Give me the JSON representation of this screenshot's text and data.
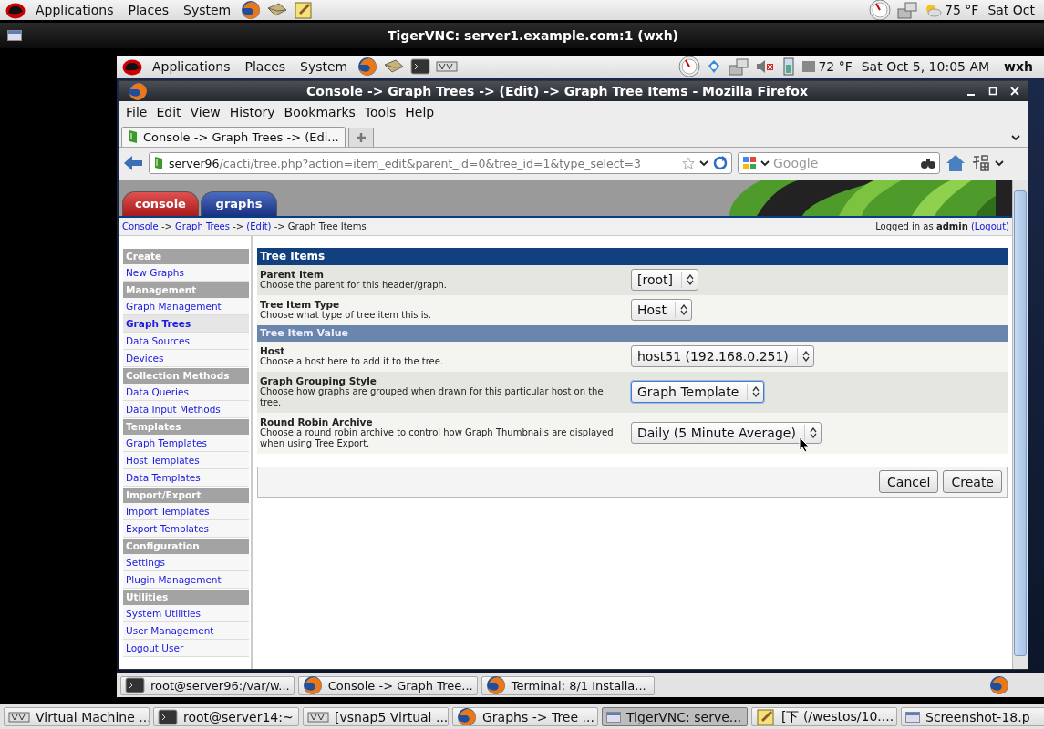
{
  "outer_panel": {
    "menus": [
      "Applications",
      "Places",
      "System"
    ],
    "weather": "75 °F",
    "clock": "Sat Oct"
  },
  "vnc_window": {
    "title": "TigerVNC: server1.example.com:1 (wxh)"
  },
  "inner_panel": {
    "menus": [
      "Applications",
      "Places",
      "System"
    ],
    "weather": "72 °F",
    "clock": "Sat Oct  5, 10:05 AM",
    "user": "wxh"
  },
  "browser": {
    "title": "Console -> Graph Trees -> (Edit) -> Graph Tree Items - Mozilla Firefox",
    "menu": [
      "File",
      "Edit",
      "View",
      "History",
      "Bookmarks",
      "Tools",
      "Help"
    ],
    "tabs": [
      {
        "label": "Console -> Graph Trees -> (Edi...",
        "selected": true
      }
    ],
    "url_host": "server96",
    "url_path": "/cacti/tree.php?action=item_edit&parent_id=0&tree_id=1&type_select=3",
    "search_placeholder": "Google"
  },
  "cacti": {
    "tabs": [
      {
        "label": "console",
        "selected": true
      },
      {
        "label": "graphs",
        "selected": false
      }
    ],
    "breadcrumb": {
      "links": [
        "Console",
        "Graph Trees",
        "(Edit)"
      ],
      "separator": "->",
      "current": "Graph Tree Items"
    },
    "login": "Logged in as **admin**",
    "logout": "(Logout)",
    "sidebar": [
      {
        "title": "Create",
        "items": [
          {
            "label": "New Graphs",
            "selected": false
          }
        ]
      },
      {
        "title": "Management",
        "items": [
          {
            "label": "Graph Management",
            "selected": false
          },
          {
            "label": "Graph Trees",
            "selected": true
          },
          {
            "label": "Data Sources",
            "selected": false
          },
          {
            "label": "Devices",
            "selected": false
          }
        ]
      },
      {
        "title": "Collection Methods",
        "items": [
          {
            "label": "Data Queries",
            "selected": false
          },
          {
            "label": "Data Input Methods",
            "selected": false
          }
        ]
      },
      {
        "title": "Templates",
        "items": [
          {
            "label": "Graph Templates",
            "selected": false
          },
          {
            "label": "Host Templates",
            "selected": false
          },
          {
            "label": "Data Templates",
            "selected": false
          }
        ]
      },
      {
        "title": "Import/Export",
        "items": [
          {
            "label": "Import Templates",
            "selected": false
          },
          {
            "label": "Export Templates",
            "selected": false
          }
        ]
      },
      {
        "title": "Configuration",
        "items": [
          {
            "label": "Settings",
            "selected": false
          },
          {
            "label": "Plugin Management",
            "selected": false
          }
        ]
      },
      {
        "title": "Utilities",
        "items": [
          {
            "label": "System Utilities",
            "selected": false
          },
          {
            "label": "User Management",
            "selected": false
          },
          {
            "label": "Logout User",
            "selected": false
          }
        ]
      }
    ],
    "form": {
      "title": "Tree Items",
      "rows": [
        {
          "kind": "field",
          "label": "Parent Item",
          "description": "Choose the parent for this header/graph.",
          "value": "[root]",
          "focused": false
        },
        {
          "kind": "field",
          "label": "Tree Item Type",
          "description": "Choose what type of tree item this is.",
          "value": "Host",
          "focused": false
        },
        {
          "kind": "subheader",
          "label": "Tree Item Value"
        },
        {
          "kind": "field",
          "label": "Host",
          "description": "Choose a host here to add it to the tree.",
          "value": "host51 (192.168.0.251)",
          "focused": false
        },
        {
          "kind": "field",
          "label": "Graph Grouping Style",
          "description": "Choose how graphs are grouped when drawn for this particular host on the tree.",
          "value": "Graph Template",
          "focused": true
        },
        {
          "kind": "field",
          "label": "Round Robin Archive",
          "description": "Choose a round robin archive to control how Graph Thumbnails are displayed when using Tree Export.",
          "value": "Daily (5 Minute Average)",
          "focused": false
        }
      ]
    },
    "buttons": [
      "Cancel",
      "Create"
    ]
  },
  "inner_taskbar": [
    {
      "kind": "terminal",
      "label": "root@server96:/var/w..."
    },
    {
      "kind": "browser",
      "label": "Console -> Graph Tree..."
    },
    {
      "kind": "browser",
      "label": "Terminal: 8/1 Installa..."
    }
  ],
  "outer_taskbar": [
    {
      "kind": "vm",
      "label": "Virtual Machine ...",
      "selected": false
    },
    {
      "kind": "terminal",
      "label": "root@server14:~",
      "selected": false
    },
    {
      "kind": "vm",
      "label": "[vsnap5 Virtual ...",
      "selected": false
    },
    {
      "kind": "browser",
      "label": "Graphs -> Tree ...",
      "selected": false
    },
    {
      "kind": "window",
      "label": "TigerVNC: serve...",
      "selected": true
    },
    {
      "kind": "editor",
      "label": "[下 (/westos/10....",
      "selected": false
    },
    {
      "kind": "screenshot",
      "label": "Screenshot-18.p",
      "selected": false
    }
  ]
}
